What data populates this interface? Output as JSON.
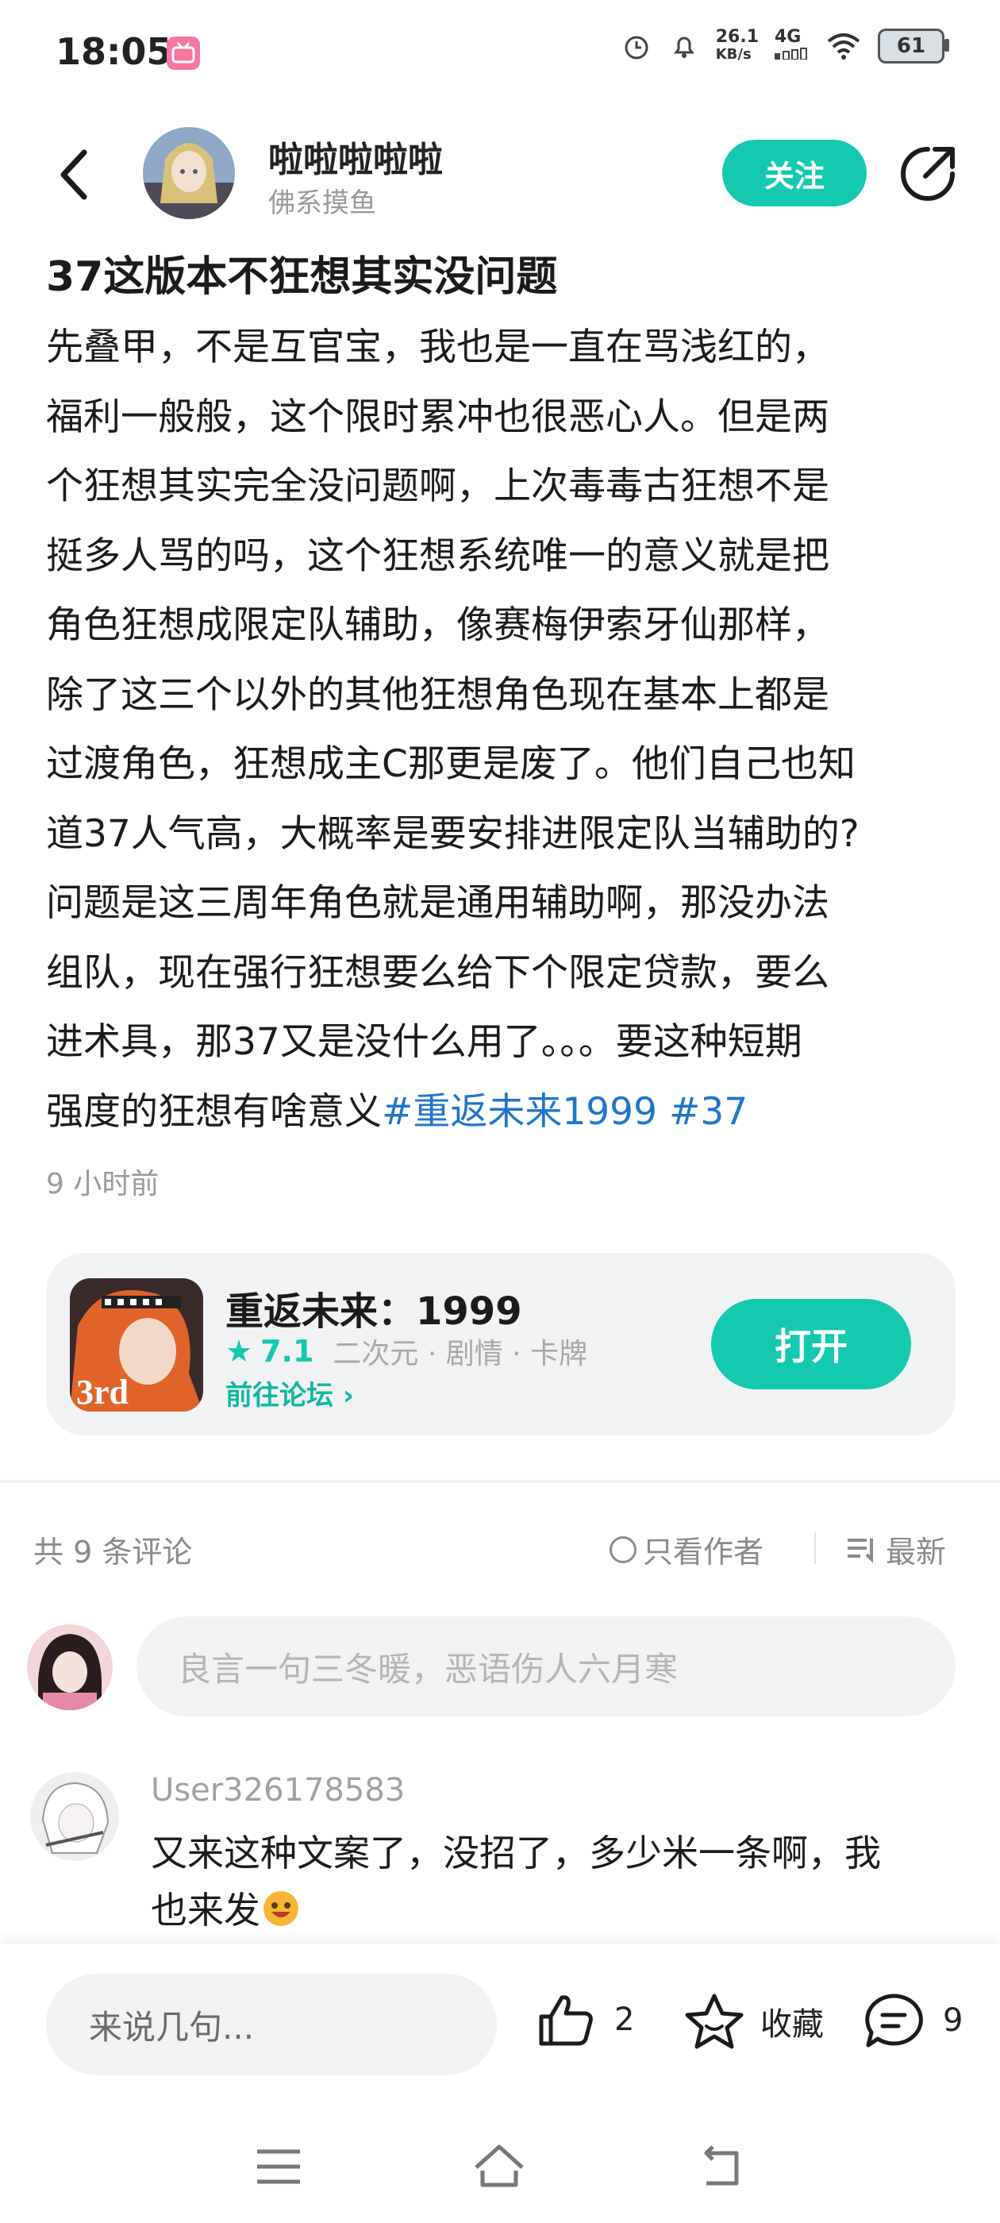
{
  "status_bar": {
    "time": "18:05",
    "net_speed_value": "26.1",
    "net_speed_unit": "KB/s",
    "network_type": "4G",
    "battery": "61"
  },
  "header": {
    "username": "啦啦啦啦啦",
    "subtitle": "佛系摸鱼",
    "follow_label": "关注"
  },
  "post": {
    "title": "37这版本不狂想其实没问题",
    "lines": [
      "先叠甲，不是互官宝，我也是一直在骂浅红的，",
      "福利一般般，这个限时累冲也很恶心人。但是两",
      "个狂想其实完全没问题啊，上次毒毒古狂想不是",
      "挺多人骂的吗，这个狂想系统唯一的意义就是把",
      "角色狂想成限定队辅助，像赛梅伊索牙仙那样，",
      "除了这三个以外的其他狂想角色现在基本上都是",
      "过渡角色，狂想成主C那更是废了。他们自己也知",
      "道37人气高，大概率是要安排进限定队当辅助的?",
      "问题是这三周年角色就是通用辅助啊，那没办法",
      "组队，现在强行狂想要么给下个限定贷款，要么",
      "进术具，那37又是没什么用了。。。要这种短期"
    ],
    "last_line_text": "强度的狂想有啥意义",
    "tags": [
      "#重返未来1999",
      "#37"
    ],
    "time_ago": "9 小时前"
  },
  "game_card": {
    "name": "重返未来：1999",
    "rating": "7.1",
    "genre": "二次元 · 剧情 · 卡牌",
    "forum_link": "前往论坛",
    "open_label": "打开",
    "icon_text": "3rd"
  },
  "comments_header": {
    "count": "共 9 条评论",
    "author_only": "只看作者",
    "sort": "最新"
  },
  "comment_input": {
    "placeholder": "良言一句三冬暖，恶语伤人六月寒"
  },
  "comments": [
    {
      "user": "User326178583",
      "lines": [
        "又来这种文案了，没招了，多少米一条啊，我",
        "也来发"
      ]
    }
  ],
  "bottom_bar": {
    "input_placeholder": "来说几句...",
    "likes": "2",
    "favorite_label": "收藏",
    "comment_count": "9"
  },
  "colors": {
    "accent": "#14c9b0",
    "tag": "#1f76c8"
  }
}
